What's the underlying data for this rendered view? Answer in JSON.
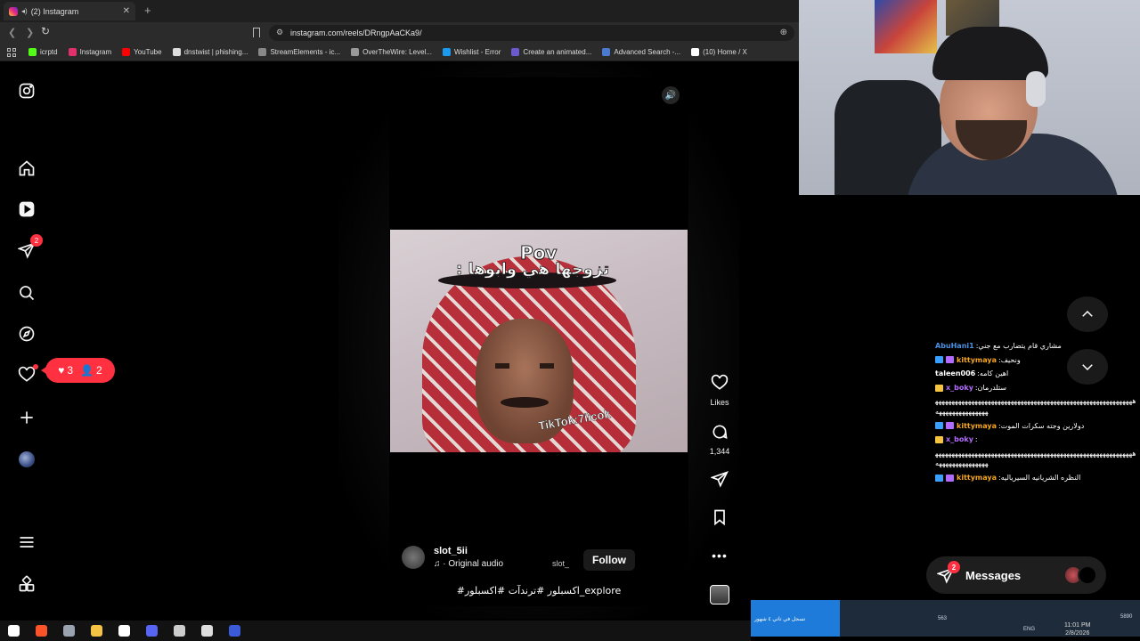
{
  "browser": {
    "tab_title": "(2) Instagram",
    "tab_close": "✕",
    "new_tab": "+",
    "url": "instagram.com/reels/DRngpAaCKa9/",
    "bookmarks": [
      {
        "label": "icrptd",
        "color": "#53fc18"
      },
      {
        "label": "Instagram",
        "color": "#e1306c"
      },
      {
        "label": "YouTube",
        "color": "#ff0000"
      },
      {
        "label": "dnstwist | phishing...",
        "color": "#dddddd"
      },
      {
        "label": "StreamElements - ic...",
        "color": "#888888"
      },
      {
        "label": "OverTheWire: Level...",
        "color": "#999999"
      },
      {
        "label": "Wishlist - Error",
        "color": "#1b9aef"
      },
      {
        "label": "Create an animated...",
        "color": "#6a5acd"
      },
      {
        "label": "Advanced Search -...",
        "color": "#4a7bd1"
      },
      {
        "label": "(10) Home / X",
        "color": "#ffffff"
      }
    ]
  },
  "instagram": {
    "sidebar": {
      "notifications_badge": "2",
      "activity": {
        "likes": "3",
        "follows": "2"
      }
    },
    "reel": {
      "overlay_title": "Pov",
      "overlay_subtitle": "تزوجها هي وابوها :",
      "watermark": "TikTok:7iicok",
      "username": "slot_5ii",
      "audio": "· Original audio",
      "audio_tag": "slot_",
      "follow_label": "Follow",
      "caption": "#اكسبلور #ترندآت #اكسبلور_explore",
      "likes_label": "Likes",
      "comments_count": "1,344"
    },
    "messages": {
      "label": "Messages",
      "badge": "2"
    }
  },
  "stream_chat": [
    {
      "user": "AbuHani1",
      "color": "#4a90e2",
      "badges": [],
      "msg": "مشاري قام يتضارب مع جني"
    },
    {
      "user": "kittymaya",
      "color": "#f5a623",
      "badges": [
        "#3aa0ff",
        "#b36bff"
      ],
      "msg": "ونحيف"
    },
    {
      "user": "taleen006",
      "color": "#ffffff",
      "badges": [],
      "msg": "اهين كامه"
    },
    {
      "user": "x_boky",
      "color": "#b36bff",
      "badges": [
        "#f5c542"
      ],
      "msg": "ستلدرمان"
    },
    {
      "user": "",
      "color": "#ffffff",
      "badges": [],
      "msg": "ههههههههههههههههههههههههههههههههههههههههههههههههههههههههههههههههههههههههههههه"
    },
    {
      "user": "kittymaya",
      "color": "#f5a623",
      "badges": [
        "#3aa0ff",
        "#b36bff"
      ],
      "msg": "دولارين وجته سكرات الموت"
    },
    {
      "user": "x_boky",
      "color": "#b36bff",
      "badges": [
        "#f5c542"
      ],
      "msg": ""
    },
    {
      "user": "",
      "color": "#ffffff",
      "badges": [],
      "msg": "ههههههههههههههههههههههههههههههههههههههههههههههههههههههههههههههههههههههههههههه"
    },
    {
      "user": "kittymaya",
      "color": "#f5a623",
      "badges": [
        "#3aa0ff",
        "#b36bff"
      ],
      "msg": "النظره الشريانيه السيرياليه"
    }
  ],
  "stream_bar": {
    "left_text": "تسجل في تاتي ٤ شهور",
    "mid_text": "563",
    "lang": "ENG",
    "time": "11:01 PM",
    "date": "2/8/2026",
    "right_text": "5890"
  },
  "taskbar_apps": [
    {
      "name": "windows",
      "color": "#ffffff"
    },
    {
      "name": "brave",
      "color": "#fb542b"
    },
    {
      "name": "explorer-window",
      "color": "#9aa4b1"
    },
    {
      "name": "file-explorer",
      "color": "#f6c244"
    },
    {
      "name": "store",
      "color": "#ffffff"
    },
    {
      "name": "discord",
      "color": "#5865f2"
    },
    {
      "name": "app-circle",
      "color": "#cccccc"
    },
    {
      "name": "obs",
      "color": "#dddddd"
    },
    {
      "name": "media",
      "color": "#3b5bdb"
    }
  ]
}
